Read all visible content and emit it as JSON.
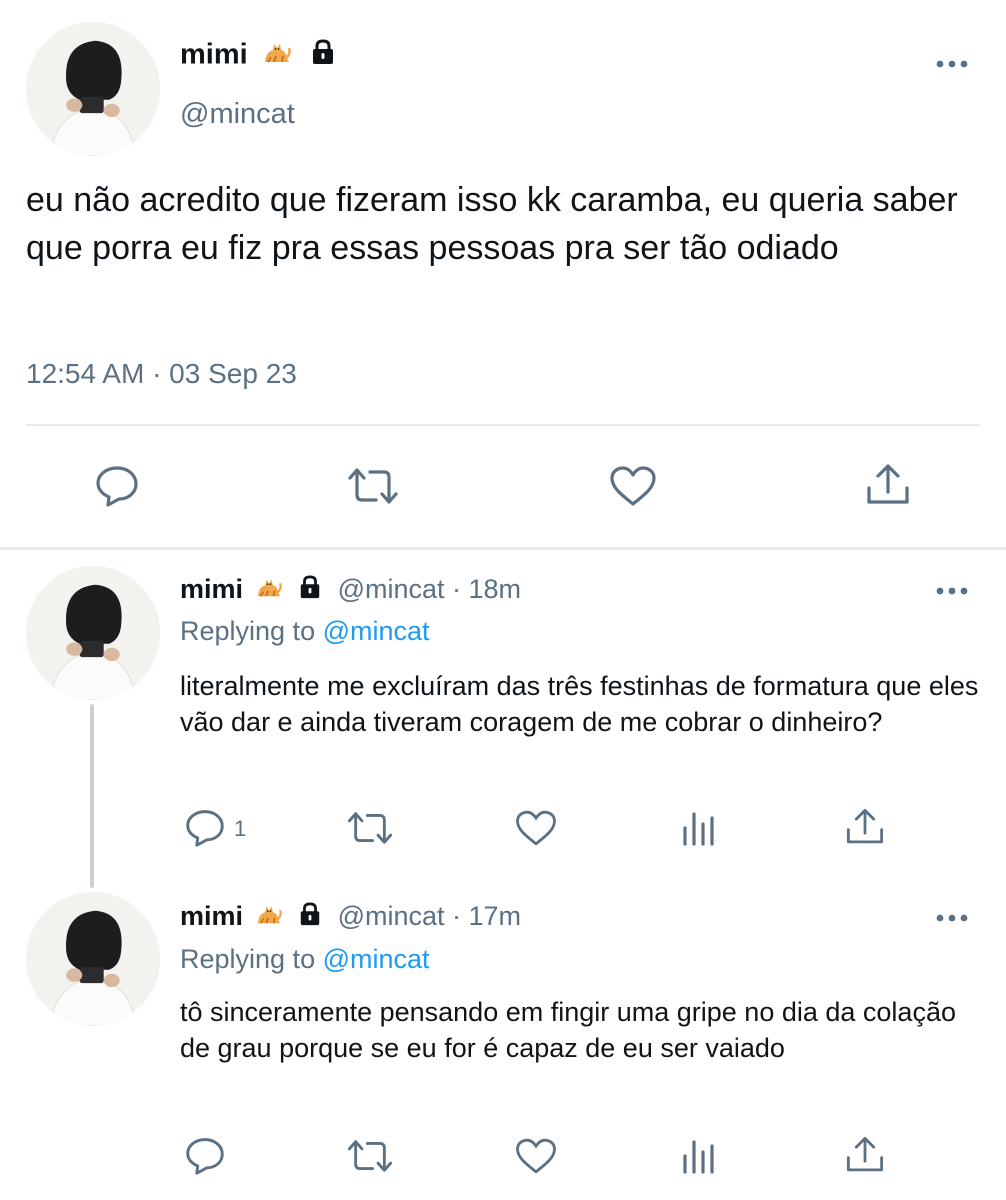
{
  "main_tweet": {
    "display_name": "mimi",
    "handle": "@mincat",
    "text": "eu não acredito que fizeram isso kk caramba, eu queria saber que porra eu fiz pra essas pessoas pra ser tão odiado",
    "timestamp": "12:54 AM · 03 Sep 23",
    "icons": [
      "cat-emoji",
      "lock-icon",
      "more-icon",
      "reply-icon",
      "retweet-icon",
      "like-icon",
      "share-icon"
    ]
  },
  "replies": [
    {
      "display_name": "mimi",
      "handle": "@mincat",
      "time": "· 18m",
      "replying_prefix": "Replying to",
      "replying_to": "@mincat",
      "text": "literalmente me excluíram das três festinhas de formatura que eles vão dar e ainda tiveram coragem de me cobrar o dinheiro?",
      "reply_count": "1"
    },
    {
      "display_name": "mimi",
      "handle": "@mincat",
      "time": "· 17m",
      "replying_prefix": "Replying to",
      "replying_to": "@mincat",
      "text": "tô sinceramente pensando em fingir uma gripe no dia da colação de grau porque se eu for é capaz de eu ser vaiado",
      "reply_count": ""
    }
  ],
  "colors": {
    "text": "#0f1419",
    "secondary": "#5b7083",
    "mention": "#1d9bf0",
    "divider": "#e6ecf0"
  }
}
